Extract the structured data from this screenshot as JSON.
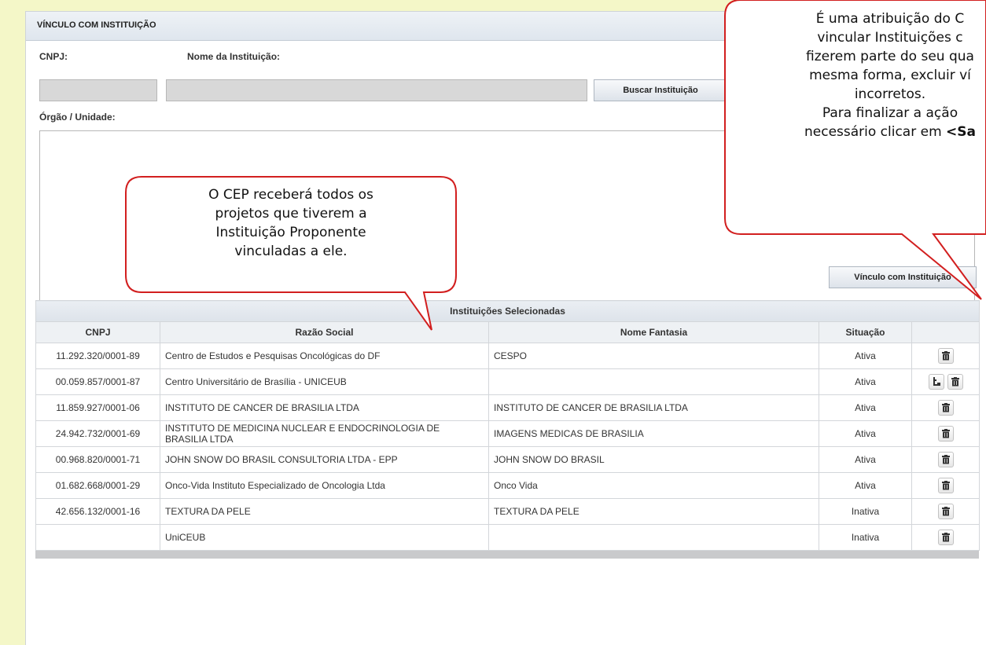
{
  "section": {
    "title": "VÍNCULO COM INSTITUIÇÃO"
  },
  "form": {
    "cnpj_label": "CNPJ:",
    "nome_label": "Nome da Instituição:",
    "buscar_button": "Buscar Instituição",
    "orgao_label": "Órgão / Unidade:",
    "vinculo_button": "Vínculo com Instituição"
  },
  "table": {
    "caption": "Instituições Selecionadas",
    "headers": [
      "CNPJ",
      "Razão Social",
      "Nome Fantasia",
      "Situação",
      ""
    ],
    "rows": [
      {
        "cnpj": "11.292.320/0001-89",
        "razao": "Centro de Estudos e Pesquisas Oncológicas do DF",
        "fantasia": "CESPO",
        "situacao": "Ativa",
        "active": true,
        "actions": [
          "delete-icon"
        ]
      },
      {
        "cnpj": "00.059.857/0001-87",
        "razao": "Centro Universitário de Brasília - UNICEUB",
        "fantasia": "",
        "situacao": "Ativa",
        "active": true,
        "actions": [
          "hierarchy-icon",
          "delete-icon"
        ]
      },
      {
        "cnpj": "11.859.927/0001-06",
        "razao": "INSTITUTO DE CANCER DE BRASILIA LTDA",
        "fantasia": "INSTITUTO DE CANCER DE BRASILIA LTDA",
        "situacao": "Ativa",
        "active": true,
        "actions": [
          "delete-icon"
        ]
      },
      {
        "cnpj": "24.942.732/0001-69",
        "razao": "INSTITUTO DE MEDICINA NUCLEAR E ENDOCRINOLOGIA DE BRASILIA LTDA",
        "fantasia": "IMAGENS MEDICAS DE BRASILIA",
        "situacao": "Ativa",
        "active": true,
        "actions": [
          "delete-icon"
        ]
      },
      {
        "cnpj": "00.968.820/0001-71",
        "razao": "JOHN SNOW DO BRASIL CONSULTORIA LTDA - EPP",
        "fantasia": "JOHN SNOW DO BRASIL",
        "situacao": "Ativa",
        "active": true,
        "actions": [
          "delete-icon"
        ]
      },
      {
        "cnpj": "01.682.668/0001-29",
        "razao": "Onco-Vida Instituto Especializado de Oncologia Ltda",
        "fantasia": "Onco Vida",
        "situacao": "Ativa",
        "active": true,
        "actions": [
          "delete-icon"
        ]
      },
      {
        "cnpj": "42.656.132/0001-16",
        "razao": "TEXTURA DA PELE",
        "fantasia": "TEXTURA DA PELE",
        "situacao": "Inativa",
        "active": false,
        "actions": [
          "delete-icon"
        ]
      },
      {
        "cnpj": "",
        "razao": "UniCEUB",
        "fantasia": "",
        "situacao": "Inativa",
        "active": false,
        "actions": [
          "delete-icon"
        ]
      }
    ]
  },
  "callouts": {
    "left": [
      "O CEP receberá todos os",
      "projetos que tiverem a",
      "Instituição Proponente",
      "vinculadas a ele."
    ],
    "right": [
      {
        "text": "É uma atribuição do C"
      },
      {
        "text": "vincular Instituições c"
      },
      {
        "text": "fizerem parte do seu qua"
      },
      {
        "text": "mesma forma, excluir ví"
      },
      {
        "text": "incorretos."
      },
      {
        "text": "Para finalizar a ação"
      },
      {
        "text": "necessário clicar em ",
        "bold": "<Sa"
      }
    ]
  },
  "colors": {
    "callout_border": "#d21f1f",
    "page_background": "#f4f7c8",
    "header_bg": "#e3e9f0"
  }
}
